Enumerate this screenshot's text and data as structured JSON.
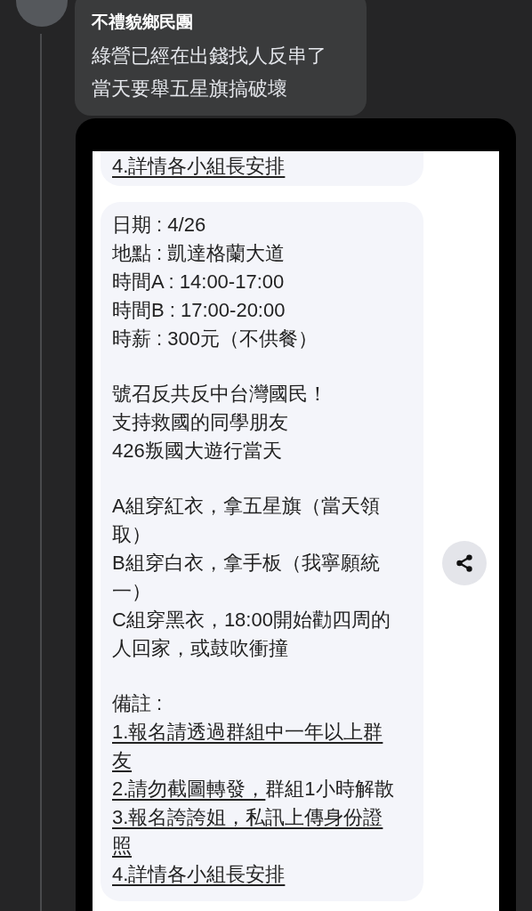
{
  "comment": {
    "author": "不禮貌鄉民團",
    "lines": [
      "綠營已經在出錢找人反串了",
      "當天要舉五星旗搞破壞"
    ]
  },
  "attachment": {
    "bubbles": [
      {
        "cut_top": true,
        "groups": [
          [
            [
              {
                "text": "4.詳情各小組長安排",
                "underlined": true
              }
            ]
          ]
        ]
      },
      {
        "cut_top": false,
        "groups": [
          [
            [
              {
                "text": "日期 : 4/26",
                "underlined": false
              }
            ],
            [
              {
                "text": "地點 : 凱達格蘭大道",
                "underlined": false
              }
            ],
            [
              {
                "text": "時間A : 14:00-17:00",
                "underlined": false
              }
            ],
            [
              {
                "text": "時間B : 17:00-20:00",
                "underlined": false
              }
            ],
            [
              {
                "text": "時薪 : 300元（不供餐）",
                "underlined": false
              }
            ]
          ],
          [
            [
              {
                "text": "號召反共反中台灣國民！",
                "underlined": false
              }
            ],
            [
              {
                "text": "支持救國的同學朋友",
                "underlined": false
              }
            ],
            [
              {
                "text": "426叛國大遊行當天",
                "underlined": false
              }
            ]
          ],
          [
            [
              {
                "text": "A組穿紅衣，拿五星旗（當天領",
                "underlined": false
              }
            ],
            [
              {
                "text": "取）",
                "underlined": false
              }
            ],
            [
              {
                "text": "B組穿白衣，拿手板（我寧願統",
                "underlined": false
              }
            ],
            [
              {
                "text": "一）",
                "underlined": false
              }
            ],
            [
              {
                "text": "C組穿黑衣，18:00開始勸四周的",
                "underlined": false
              }
            ],
            [
              {
                "text": "人回家，或鼓吹衝撞",
                "underlined": false
              }
            ]
          ],
          [
            [
              {
                "text": "備註 :",
                "underlined": false
              }
            ],
            [
              {
                "text": "1.報名請透過群組中一年以上群",
                "underlined": true
              }
            ],
            [
              {
                "text": "友",
                "underlined": true
              }
            ],
            [
              {
                "text": "2.請勿截圖轉發，",
                "underlined": true
              },
              {
                "text": "群組1小時解散",
                "underlined": false
              }
            ],
            [
              {
                "text": "3.報名誇誇姐，私訊上傳身份證",
                "underlined": true
              }
            ],
            [
              {
                "text": "照",
                "underlined": true
              }
            ],
            [
              {
                "text": "4.詳情各小組長安排",
                "underlined": true
              }
            ]
          ]
        ]
      }
    ]
  }
}
